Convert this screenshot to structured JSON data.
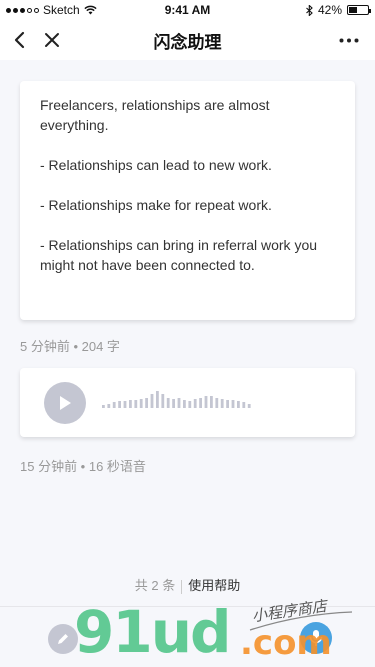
{
  "status_bar": {
    "carrier": "Sketch",
    "time": "9:41 AM",
    "battery": "42%",
    "battery_level": 0.42
  },
  "nav": {
    "title": "闪念助理"
  },
  "note": {
    "paragraphs": [
      "Freelancers, relationships are almost everything.",
      "- Relationships can lead to new work.",
      "- Relationships make for repeat work.",
      "- Relationships can bring in referral work you might not have been connected to."
    ],
    "meta": "5 分钟前 • 204 字"
  },
  "voice": {
    "meta": "15 分钟前 • 16 秒语音"
  },
  "footer": {
    "count": "共 2 条",
    "help": "使用帮助"
  },
  "watermark": {
    "logo": "91ud",
    "domain": ".com",
    "tagline": "小程序商店"
  }
}
